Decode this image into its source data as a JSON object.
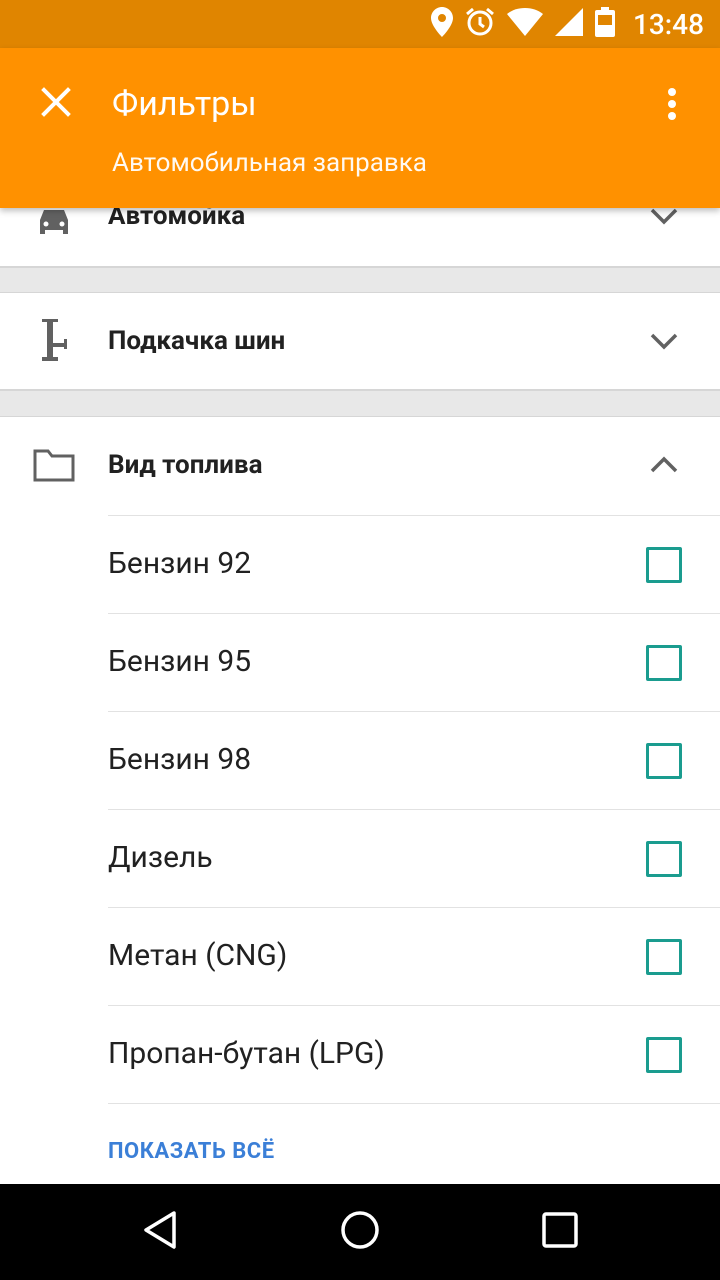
{
  "status_bar": {
    "time": "13:48",
    "icons": [
      "location-icon",
      "alarm-icon",
      "wifi-icon",
      "signal-icon",
      "battery-icon"
    ]
  },
  "app_bar": {
    "title": "Фильтры",
    "subtitle": "Автомобильная заправка",
    "background": "#ff9100"
  },
  "filters": {
    "car_wash": {
      "label": "Автомойка",
      "icon": "car-wash-icon",
      "expanded": false
    },
    "tire_pump": {
      "label": "Подкачка шин",
      "icon": "tire-pump-icon",
      "expanded": false
    },
    "fuel_type": {
      "label": "Вид топлива",
      "icon": "folder-icon",
      "expanded": true,
      "options": [
        {
          "label": "Бензин 92",
          "checked": false
        },
        {
          "label": "Бензин 95",
          "checked": false
        },
        {
          "label": "Бензин 98",
          "checked": false
        },
        {
          "label": "Дизель",
          "checked": false
        },
        {
          "label": "Метан (CNG)",
          "checked": false
        },
        {
          "label": "Пропан-бутан (LPG)",
          "checked": false
        }
      ],
      "show_all": "ПОКАЗАТЬ ВСЁ"
    }
  },
  "colors": {
    "accent": "#ff9100",
    "checkbox": "#1a9c8f",
    "link": "#3b7fd7"
  }
}
